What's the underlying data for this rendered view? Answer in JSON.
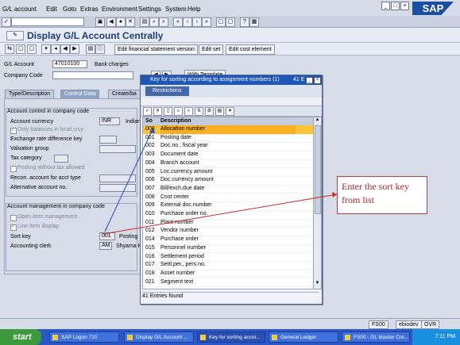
{
  "menu": [
    "G/L account",
    "Edit",
    "Goto",
    "Extras",
    "Environment",
    "Settings",
    "System",
    "Help"
  ],
  "logo": "SAP",
  "title": "Display G/L Account Centrally",
  "buttons": {
    "edit_fs": "Edit financial statement version",
    "edit_set": "Edit set",
    "edit_cost": "Edit cost element",
    "with_template": "With Template"
  },
  "header": {
    "gl_label": "G/L Account",
    "gl_value": "47010100",
    "gl_text": "Bank charges",
    "cc_label": "Company Code"
  },
  "tabs": [
    "Type/Description",
    "Control Data",
    "Create/ba"
  ],
  "control": {
    "section_title": "Account control in company code",
    "currency_label": "Account currency",
    "currency_value": "INR",
    "currency_text": "Indian",
    "only_balances": "Only balances in local crcy",
    "exchange": "Exchange rate difference key",
    "valuation": "Valuation group",
    "tax": "Tax category",
    "posting_wo_tax": "Posting without tax allowed",
    "recon": "Recon. account for acct type",
    "alternative": "Alternative account no."
  },
  "mgmt": {
    "section_title": "Account management in company code",
    "open_item": "Open item management",
    "line_item": "Line item display",
    "sort_label": "Sort key",
    "sort_value": "001",
    "posting_text": "Posting",
    "clerk_label": "Accounting clerk",
    "clerk_value": "AM",
    "clerk_text": "Shyama K"
  },
  "popup": {
    "title": "Key for sorting according to assignment numbers (1)",
    "title_extra": "41 E",
    "tab": "Restrictions",
    "col_key": "So",
    "col_desc": "Description",
    "rows": [
      {
        "key": "000",
        "desc": "Allocation number"
      },
      {
        "key": "001",
        "desc": "Posting date"
      },
      {
        "key": "002",
        "desc": "Doc.no., fiscal year"
      },
      {
        "key": "003",
        "desc": "Document date"
      },
      {
        "key": "004",
        "desc": "Branch account"
      },
      {
        "key": "005",
        "desc": "Loc.currency amount"
      },
      {
        "key": "006",
        "desc": "Doc.currency amount"
      },
      {
        "key": "007",
        "desc": "Bill/exch.due date"
      },
      {
        "key": "008",
        "desc": "Cost center"
      },
      {
        "key": "009",
        "desc": "External doc.number"
      },
      {
        "key": "010",
        "desc": "Purchase order no."
      },
      {
        "key": "011",
        "desc": "Plant number"
      },
      {
        "key": "012",
        "desc": "Vendor number"
      },
      {
        "key": "014",
        "desc": "Purchase order"
      },
      {
        "key": "015",
        "desc": "Personnel number"
      },
      {
        "key": "016",
        "desc": "Settlement period"
      },
      {
        "key": "017",
        "desc": "Settl.per., pers.no."
      },
      {
        "key": "018",
        "desc": "Asset number"
      },
      {
        "key": "021",
        "desc": "Segment text"
      }
    ],
    "status": "41 Entries found"
  },
  "callout": "Enter the sort key from list",
  "statusbar": {
    "tcode": "FS00",
    "server": "ebiodev",
    "mode": "OVR"
  },
  "taskbar": {
    "start": "start",
    "tasks": [
      "SAP Logon 710",
      "Display G/L Account ...",
      "Key for sorting accor...",
      "General Ledger",
      "FS00 - GL Master Cre..."
    ],
    "clock": "7:11 PM"
  }
}
